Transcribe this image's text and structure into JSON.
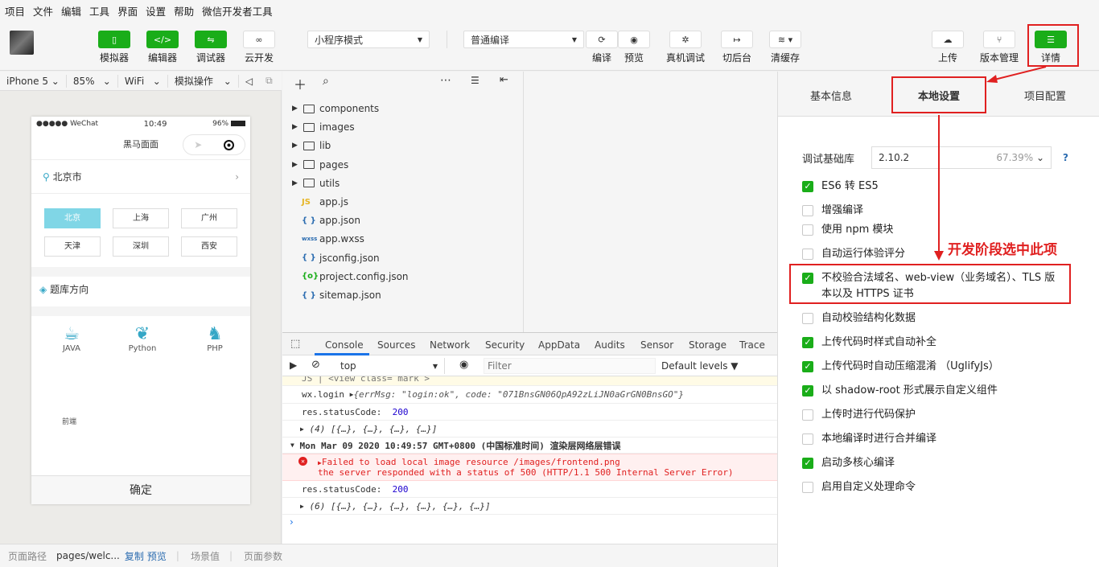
{
  "menu": [
    "项目",
    "文件",
    "编辑",
    "工具",
    "界面",
    "设置",
    "帮助",
    "微信开发者工具"
  ],
  "toolbar": {
    "simulator": "模拟器",
    "editor": "编辑器",
    "debugger": "调试器",
    "cloud": "云开发",
    "mode_select": "小程序模式",
    "compile_select": "普通编译",
    "compile": "编译",
    "preview": "预览",
    "remote_debug": "真机调试",
    "background": "切后台",
    "clear_cache": "清缓存",
    "upload": "上传",
    "version": "版本管理",
    "details": "详情"
  },
  "devbar": {
    "device": "iPhone 5",
    "zoom": "85%",
    "network": "WiFi",
    "operation": "模拟操作"
  },
  "phone": {
    "status_left": "●●●●● WeChat",
    "time": "10:49",
    "battery": "96%",
    "title": "黑马面面",
    "location": "北京市",
    "cities": [
      "北京",
      "上海",
      "广州",
      "天津",
      "深圳",
      "西安"
    ],
    "section": "题库方向",
    "langs": [
      "JAVA",
      "Python",
      "PHP"
    ],
    "frontend": "前端",
    "confirm": "确定"
  },
  "files": [
    {
      "name": "components",
      "type": "folder"
    },
    {
      "name": "images",
      "type": "folder"
    },
    {
      "name": "lib",
      "type": "folder"
    },
    {
      "name": "pages",
      "type": "folder"
    },
    {
      "name": "utils",
      "type": "folder"
    },
    {
      "name": "app.js",
      "type": "js",
      "icon": "JS"
    },
    {
      "name": "app.json",
      "type": "json",
      "icon": "{ }"
    },
    {
      "name": "app.wxss",
      "type": "wxss",
      "icon": "wxss"
    },
    {
      "name": "jsconfig.json",
      "type": "json",
      "icon": "{ }"
    },
    {
      "name": "project.config.json",
      "type": "config",
      "icon": "{o}"
    },
    {
      "name": "sitemap.json",
      "type": "json",
      "icon": "{ }"
    }
  ],
  "console": {
    "tabs": [
      "Console",
      "Sources",
      "Network",
      "Security",
      "AppData",
      "Audits",
      "Sensor",
      "Storage",
      "Trace"
    ],
    "context": "top",
    "filter_placeholder": "Filter",
    "levels": "Default levels ▼",
    "lines": {
      "l0": "JS |            <view class= mark >",
      "l1a": "wx.login",
      "l1b": "{errMsg: \"login:ok\", code: \"071BnsGN06QpA92zLiJN0aGrGN0BnsGO\"}",
      "l2a": "res.statusCode:",
      "l2b": "200",
      "l3": "(4) [{…}, {…}, {…}, {…}]",
      "l4": "Mon Mar 09 2020 10:49:57 GMT+0800 (中国标准时间) 渲染层网络层错误",
      "l5a": "Failed to load local image resource /images/frontend.png",
      "l5b": "the server responded with a status of 500 (HTTP/1.1 500 Internal Server Error)",
      "l6a": "res.statusCode:",
      "l6b": "200",
      "l7": "(6) [{…}, {…}, {…}, {…}, {…}, {…}]"
    }
  },
  "footer": {
    "path_label": "页面路径",
    "path": "pages/welc...",
    "copy": "复制",
    "preview": "预览",
    "scene": "场景值",
    "params": "页面参数"
  },
  "details": {
    "tabs": [
      "基本信息",
      "本地设置",
      "项目配置"
    ],
    "lib_label": "调试基础库",
    "lib_version": "2.10.2",
    "lib_percent": "67.39%",
    "options": [
      {
        "label": "ES6 转 ES5",
        "checked": true
      },
      {
        "label": "增强编译",
        "checked": false
      },
      {
        "label": "使用 npm 模块",
        "checked": false
      },
      {
        "label": "自动运行体验评分",
        "checked": false
      },
      {
        "label": "不校验合法域名、web-view（业务域名）、TLS 版本以及 HTTPS 证书",
        "checked": true
      },
      {
        "label": "自动校验结构化数据",
        "checked": false
      },
      {
        "label": "上传代码时样式自动补全",
        "checked": true
      },
      {
        "label": "上传代码时自动压缩混淆 （UglifyJs）",
        "checked": true
      },
      {
        "label": "以 shadow-root 形式展示自定义组件",
        "checked": true
      },
      {
        "label": "上传时进行代码保护",
        "checked": false
      },
      {
        "label": "本地编译时进行合并编译",
        "checked": false
      },
      {
        "label": "启动多核心编译",
        "checked": true
      },
      {
        "label": "启用自定义处理命令",
        "checked": false
      }
    ]
  },
  "annotation": "开发阶段选中此项",
  "colors": {
    "green": "#1aad19",
    "red": "#e02020",
    "accent": "#80d6e6"
  }
}
